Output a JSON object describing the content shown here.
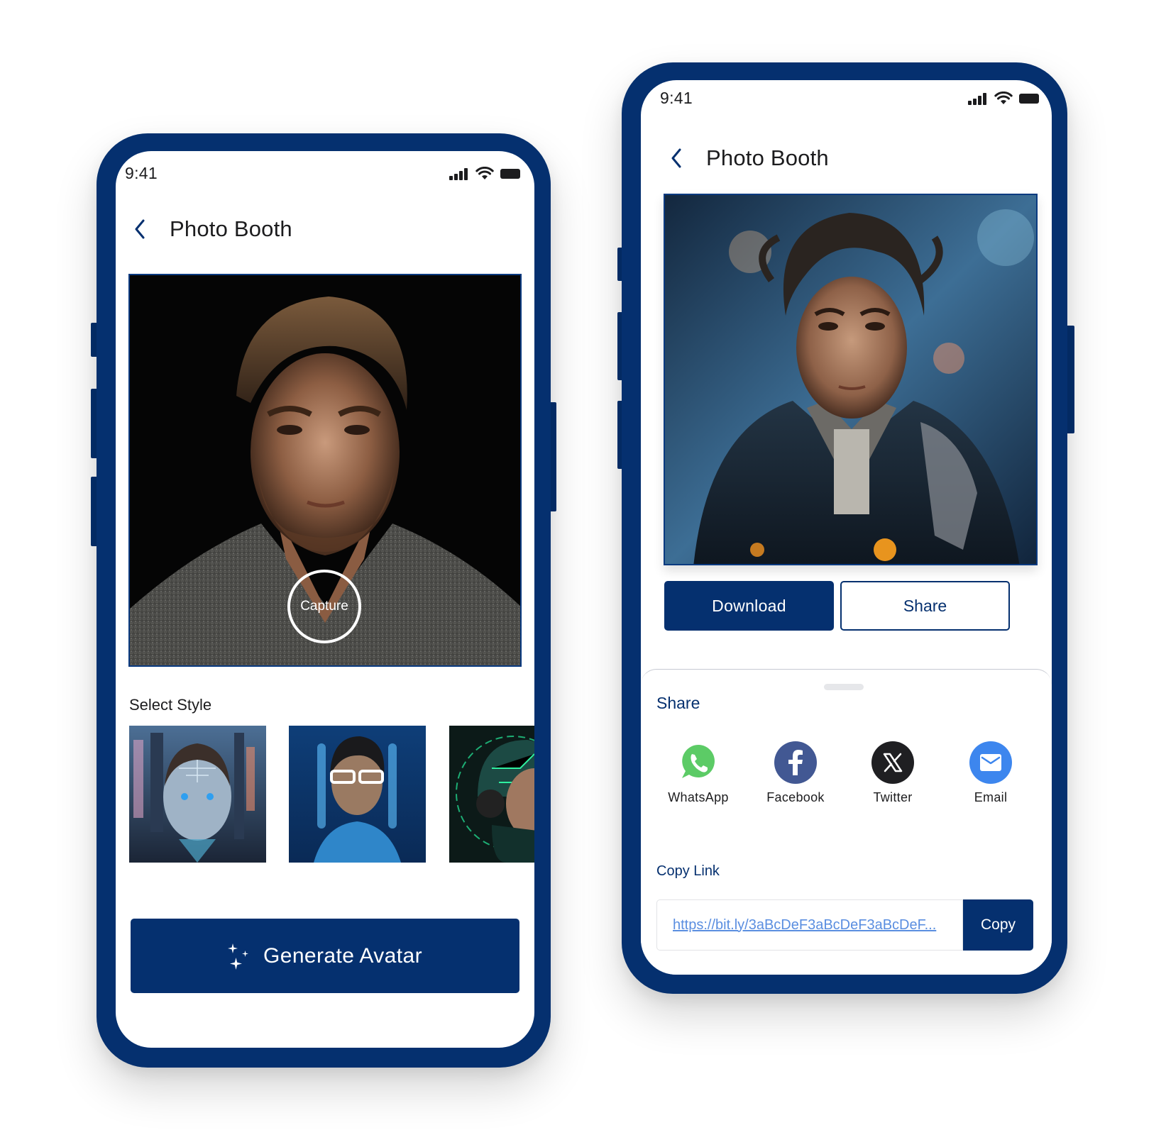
{
  "colors": {
    "brand_navy": "#05306f",
    "link_blue": "#5a8ee0",
    "whatsapp_green": "#5ccb66",
    "facebook_blue": "#425893",
    "twitter_black": "#1f1f22",
    "email_blue": "#3d86ee"
  },
  "capture_screen": {
    "status_bar": {
      "time": "9:41",
      "icons": [
        "signal-icon",
        "wifi-icon",
        "battery-icon"
      ]
    },
    "header": {
      "back_icon": "chevron-left-icon",
      "title": "Photo Booth"
    },
    "camera_preview": {
      "capture_label": "Capture"
    },
    "style_section": {
      "label": "Select Style",
      "styles": [
        {
          "name": "cyborg-city-woman"
        },
        {
          "name": "neon-glasses-man"
        },
        {
          "name": "green-circuit-woman"
        }
      ]
    },
    "generate_button": {
      "icon": "sparkles-icon",
      "label": "Generate Avatar"
    }
  },
  "result_screen": {
    "status_bar": {
      "time": "9:41",
      "icons": [
        "signal-icon",
        "wifi-icon",
        "battery-icon"
      ]
    },
    "header": {
      "back_icon": "chevron-left-icon",
      "title": "Photo Booth"
    },
    "actions": {
      "download_label": "Download",
      "share_label": "Share"
    },
    "share_sheet": {
      "title": "Share",
      "targets": [
        {
          "label": "WhatsApp",
          "icon": "whatsapp-icon"
        },
        {
          "label": "Facebook",
          "icon": "facebook-icon"
        },
        {
          "label": "Twitter",
          "icon": "x-twitter-icon"
        },
        {
          "label": "Email",
          "icon": "email-icon"
        }
      ],
      "copy_link": {
        "label": "Copy Link",
        "url": "https://bit.ly/3aBcDeF3aBcDeF3aBcDeF...",
        "button_label": "Copy"
      }
    }
  }
}
